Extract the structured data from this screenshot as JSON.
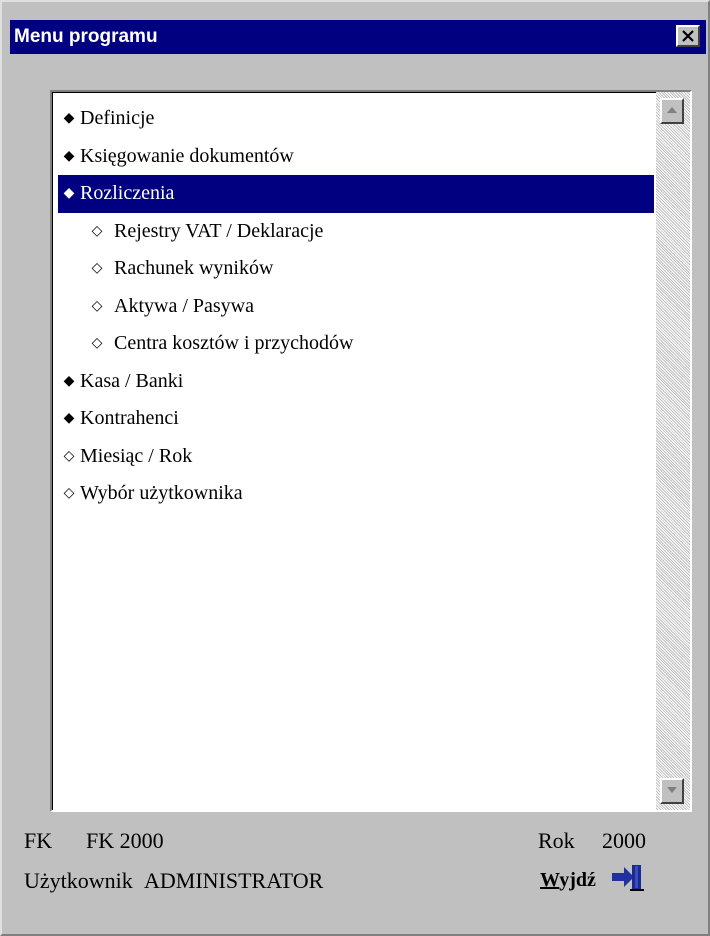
{
  "window": {
    "title": "Menu programu",
    "close_icon": "close-icon"
  },
  "menu": {
    "items": [
      {
        "label": "Definicje",
        "bullet": "◆",
        "level": 0,
        "selected": false
      },
      {
        "label": "Księgowanie dokumentów",
        "bullet": "◆",
        "level": 0,
        "selected": false
      },
      {
        "label": "Rozliczenia",
        "bullet": "◆",
        "level": 0,
        "selected": true
      },
      {
        "label": "Rejestry VAT / Deklaracje",
        "bullet": "◇",
        "level": 1,
        "selected": false
      },
      {
        "label": "Rachunek wyników",
        "bullet": "◇",
        "level": 1,
        "selected": false
      },
      {
        "label": "Aktywa / Pasywa",
        "bullet": "◇",
        "level": 1,
        "selected": false
      },
      {
        "label": "Centra kosztów i przychodów",
        "bullet": "◇",
        "level": 1,
        "selected": false
      },
      {
        "label": "Kasa / Banki",
        "bullet": "◆",
        "level": 0,
        "selected": false
      },
      {
        "label": "Kontrahenci",
        "bullet": "◆",
        "level": 0,
        "selected": false
      },
      {
        "label": "Miesiąc / Rok",
        "bullet": "◇",
        "level": 0,
        "selected": false
      },
      {
        "label": "Wybór użytkownika",
        "bullet": "◇",
        "level": 0,
        "selected": false
      }
    ]
  },
  "footer": {
    "module_code": "FK",
    "module_name": "FK 2000",
    "year_label": "Rok",
    "year_value": "2000",
    "user_label": "Użytkownik",
    "user_value": "ADMINISTRATOR",
    "exit_label": "Wyjdź",
    "exit_icon": "exit-door-icon"
  },
  "colors": {
    "titlebar": "#000080",
    "selection": "#000080",
    "face": "#c0c0c0"
  }
}
